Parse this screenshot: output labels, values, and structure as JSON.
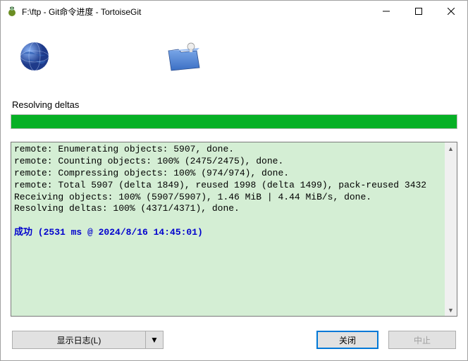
{
  "titlebar": {
    "text": "F:\\ftp - Git命令进度 - TortoiseGit"
  },
  "status": {
    "label": "Resolving deltas"
  },
  "console": {
    "lines": [
      "remote: Enumerating objects: 5907, done.",
      "remote: Counting objects: 100% (2475/2475), done.",
      "remote: Compressing objects: 100% (974/974), done.",
      "remote: Total 5907 (delta 1849), reused 1998 (delta 1499), pack-reused 3432",
      "Receiving objects: 100% (5907/5907), 1.46 MiB | 4.44 MiB/s, done.",
      "Resolving deltas: 100% (4371/4371), done."
    ],
    "success_line": "成功 (2531 ms @ 2024/8/16 14:45:01)"
  },
  "buttons": {
    "show_log": "显示日志(L)",
    "dropdown_glyph": "▼",
    "close": "关闭",
    "abort": "中止"
  }
}
